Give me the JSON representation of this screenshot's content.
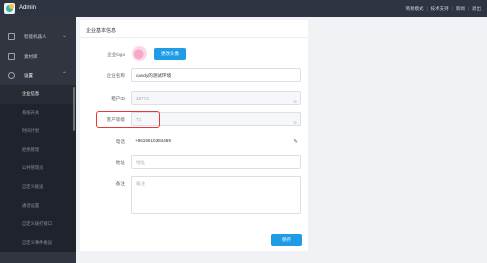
{
  "app": {
    "title": "Admin",
    "logo_icon": "app-logo-icon"
  },
  "header": {
    "links": [
      "简易模式",
      "技术支持",
      "新闻",
      "退出"
    ]
  },
  "sidebar": {
    "groups": [
      {
        "label": "智能机器人",
        "icon": "robot-icon",
        "expanded": false
      },
      {
        "label": "素材库",
        "icon": "folder-icon"
      },
      {
        "label": "设置",
        "icon": "gear-icon",
        "expanded": true
      }
    ],
    "subitems": [
      {
        "label": "企业信息",
        "active": true
      },
      {
        "label": "系统开关"
      },
      {
        "label": "时间计划"
      },
      {
        "label": "拒绝管理"
      },
      {
        "label": "公共管理员"
      },
      {
        "label": "自定义推送"
      },
      {
        "label": "通话设置"
      },
      {
        "label": "自定义拨打接口"
      },
      {
        "label": "自定义事件推送"
      }
    ]
  },
  "card": {
    "title": "企业基本信息",
    "logo_label": "企业logo",
    "change_avatar_button": "更改头像",
    "fields": {
      "name": {
        "label": "企业名称",
        "value": "candy的测试环境"
      },
      "tenant_id": {
        "label": "租户ID",
        "value": "28773"
      },
      "customer_level": {
        "label": "客户等级",
        "value": "T1"
      },
      "phone": {
        "label": "电话",
        "value": "+8615510384469"
      },
      "address": {
        "label": "地址",
        "placeholder": "地址"
      },
      "remark": {
        "label": "备注",
        "placeholder": "备注"
      }
    },
    "save_button": "保存"
  },
  "colors": {
    "accent": "#1e9de6",
    "highlight": "#e53935",
    "sidebar": "#303540",
    "topbar": "#2f3442"
  }
}
